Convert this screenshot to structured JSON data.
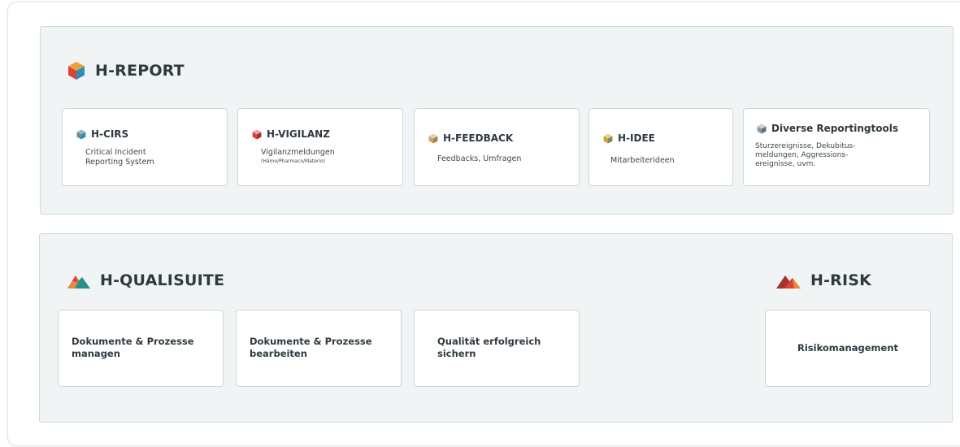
{
  "report": {
    "title": "H-REPORT",
    "cards": [
      {
        "title": "H-CIRS",
        "lines": [
          "Critical Incident",
          "Reporting System"
        ],
        "icon_color": "#2f8fb0"
      },
      {
        "title": "H-VIGILANZ",
        "lines": [
          "Vigilanzmeldungen"
        ],
        "small_line": "(Hämo/Pharmaco/Materio)",
        "icon_color": "#d9433b"
      },
      {
        "title": "H-FEEDBACK",
        "lines": [
          "Feedbacks, Umfragen"
        ],
        "icon_color": "#c8a56a"
      },
      {
        "title": "H-IDEE",
        "lines": [
          "Mitarbeiterideen"
        ],
        "icon_color": "#c9a43a"
      },
      {
        "title": "Diverse Reportingtools",
        "lines": [
          "Sturzereignisse, Dekubitus-",
          "meldungen, Aggressions-",
          "ereignisse, uvm."
        ],
        "icon_color": "#8a9aa2"
      }
    ]
  },
  "quali": {
    "title": "H-QUALISUITE",
    "cards": [
      {
        "lines": [
          "Dokumente & Prozesse",
          "managen"
        ]
      },
      {
        "lines": [
          "Dokumente & Prozesse",
          "bearbeiten"
        ]
      },
      {
        "lines": [
          "Qualität erfolgreich",
          "sichern"
        ]
      }
    ]
  },
  "risk": {
    "title": "H-RISK",
    "card_label": "Risikomanagement"
  },
  "colors": {
    "panel_bg": "#f1f4f5",
    "panel_border": "#c7dede",
    "text_dark": "#2e3a40",
    "cube_orange": "#e9a23b",
    "cube_red": "#d9433b",
    "cube_teal": "#2f8fb0",
    "mountain_red": "#d9433b",
    "mountain_orange": "#e98a3b",
    "mountain_teal": "#2a8f8a"
  }
}
